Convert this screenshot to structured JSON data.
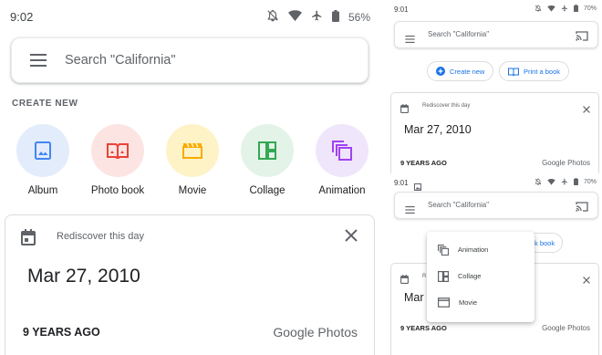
{
  "main": {
    "status": {
      "time": "9:02",
      "battery": "56%"
    },
    "search": {
      "placeholder": "Search \"California\""
    },
    "create_new_label": "CREATE NEW",
    "creators": [
      {
        "label": "Album",
        "color": "#e3ecfb",
        "icon": "album-icon"
      },
      {
        "label": "Photo book",
        "color": "#fce4e2",
        "icon": "photo-book-icon"
      },
      {
        "label": "Movie",
        "color": "#fef3c7",
        "icon": "movie-icon"
      },
      {
        "label": "Collage",
        "color": "#e3f3e7",
        "icon": "collage-icon"
      },
      {
        "label": "Animation",
        "color": "#f0e6fb",
        "icon": "animation-icon"
      }
    ],
    "card": {
      "title": "Rediscover this day",
      "date": "Mar 27, 2010",
      "ago": "9 YEARS AGO",
      "brand": "Google Photos"
    }
  },
  "right_top": {
    "status": {
      "time": "9:01",
      "battery": "70%"
    },
    "search": {
      "placeholder": "Search \"California\""
    },
    "buttons": {
      "create_new": "Create new",
      "print_book": "Print a book"
    },
    "card": {
      "title": "Rediscover this day",
      "date": "Mar 27, 2010",
      "ago": "9 YEARS AGO",
      "brand": "Google Photos"
    }
  },
  "right_bottom": {
    "status": {
      "time": "9:01",
      "battery": "70%"
    },
    "search": {
      "placeholder": "Search \"California\""
    },
    "partial_button": "k book",
    "menu": [
      "Animation",
      "Collage",
      "Movie"
    ],
    "card": {
      "title_fragment": "R",
      "date_fragment": "Mar",
      "ago": "9 YEARS AGO",
      "brand": "Google Photos"
    }
  },
  "colors": {
    "accent": "#1a73e8",
    "album": "#4285f4",
    "book": "#ea4335",
    "movie": "#fbbc04",
    "collage": "#34a853",
    "animation": "#a142f4"
  }
}
